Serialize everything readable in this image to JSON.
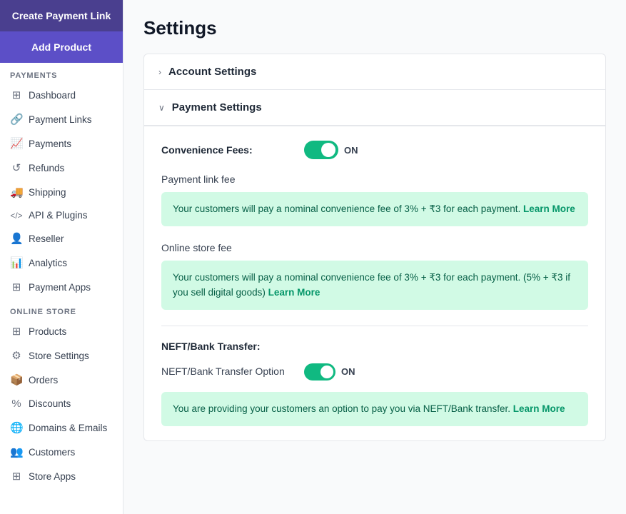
{
  "sidebar": {
    "buttons": {
      "create_payment": "Create Payment Link",
      "add_product": "Add Product"
    },
    "sections": [
      {
        "label": "PAYMENTS",
        "items": [
          {
            "name": "dashboard",
            "icon": "⊞",
            "label": "Dashboard"
          },
          {
            "name": "payment-links",
            "icon": "🔗",
            "label": "Payment Links"
          },
          {
            "name": "payments",
            "icon": "📈",
            "label": "Payments"
          },
          {
            "name": "refunds",
            "icon": "↺",
            "label": "Refunds"
          },
          {
            "name": "shipping",
            "icon": "🚚",
            "label": "Shipping"
          },
          {
            "name": "api-plugins",
            "icon": "</>",
            "label": "API & Plugins"
          },
          {
            "name": "reseller",
            "icon": "👤",
            "label": "Reseller"
          },
          {
            "name": "analytics",
            "icon": "📊",
            "label": "Analytics"
          },
          {
            "name": "payment-apps",
            "icon": "⊞",
            "label": "Payment Apps"
          }
        ]
      },
      {
        "label": "ONLINE STORE",
        "items": [
          {
            "name": "products",
            "icon": "⊞",
            "label": "Products"
          },
          {
            "name": "store-settings",
            "icon": "⚙",
            "label": "Store Settings"
          },
          {
            "name": "orders",
            "icon": "📦",
            "label": "Orders"
          },
          {
            "name": "discounts",
            "icon": "%",
            "label": "Discounts"
          },
          {
            "name": "domains-emails",
            "icon": "🌐",
            "label": "Domains & Emails"
          },
          {
            "name": "customers",
            "icon": "👥",
            "label": "Customers"
          },
          {
            "name": "store-apps",
            "icon": "⊞",
            "label": "Store Apps"
          }
        ]
      }
    ]
  },
  "page": {
    "title": "Settings"
  },
  "accordion": {
    "account_settings": {
      "label": "Account Settings",
      "expanded": false
    },
    "payment_settings": {
      "label": "Payment Settings",
      "expanded": true,
      "convenience_fees": {
        "label": "Convenience Fees:",
        "toggle_status": "ON",
        "payment_link_fee": {
          "section_title": "Payment link fee",
          "info_text": "Your customers will pay a nominal convenience fee of 3% + ₹3 for each payment.",
          "learn_more": "Learn More"
        },
        "online_store_fee": {
          "section_title": "Online store fee",
          "info_text": "Your customers will pay a nominal convenience fee of 3% + ₹3 for each payment. (5% + ₹3 if you sell digital goods)",
          "learn_more": "Learn More"
        }
      },
      "neft_bank_transfer": {
        "label": "NEFT/Bank Transfer:",
        "option_label": "NEFT/Bank Transfer Option",
        "toggle_status": "ON",
        "info_text": "You are providing your customers an option to pay you via NEFT/Bank transfer.",
        "learn_more": "Learn More"
      }
    }
  }
}
